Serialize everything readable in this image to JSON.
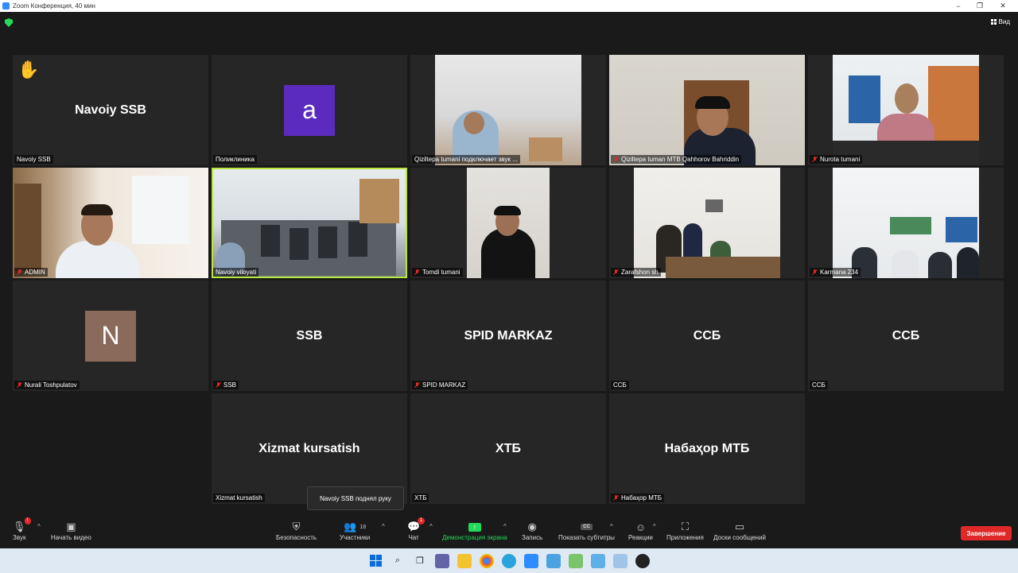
{
  "window": {
    "title": "Zoom Конференция, 40 мин",
    "minimize": "−",
    "maximize": "❐",
    "close": "✕"
  },
  "topbar": {
    "view_label": "Вид"
  },
  "tiles": [
    {
      "name": "Navoiy SSB",
      "display": "Navoiy SSB",
      "hand": "✋"
    },
    {
      "name": "Поликлиника",
      "avatar": "a"
    },
    {
      "name": "Qiziltepa tumani подключает звук ..."
    },
    {
      "name": "Qiziltepa tuman  MTB Qahhorov Bahriddin"
    },
    {
      "name": "Nurota tumani"
    },
    {
      "name": "ADMIN"
    },
    {
      "name": "Navoiy viloyati"
    },
    {
      "name": "Tomdi tumani"
    },
    {
      "name": "Zarafshon sh"
    },
    {
      "name": "Karmana 234"
    },
    {
      "name": "Nurali Toshpulatov",
      "avatar": "N"
    },
    {
      "name": "SSB",
      "display": "SSB"
    },
    {
      "name": "SPID MARKAZ",
      "display": "SPID MARKAZ"
    },
    {
      "name": "ССБ",
      "display": "ССБ"
    },
    {
      "name": "ССБ",
      "display": "ССБ"
    },
    {
      "name": "Xizmat kursatish",
      "display": "Xizmat kursatish"
    },
    {
      "name": "ХТБ",
      "display": "ХТБ"
    },
    {
      "name": "Набаҳор МТБ",
      "display": "Набаҳор МТБ"
    }
  ],
  "tooltip": "Navoiy SSB поднял руку",
  "toolbar": {
    "audio": "Звук",
    "audio_badge": "!",
    "video": "Начать видео",
    "security": "Безопасность",
    "participants": "Участники",
    "participants_count": "18",
    "chat": "Чат",
    "chat_badge": "1",
    "share": "Демонстрация экрана",
    "record": "Запись",
    "captions": "Показать субтитры",
    "captions_icon": "CC",
    "reactions": "Реакции",
    "apps": "Приложения",
    "whiteboards": "Доски сообщений",
    "end": "Завершение"
  },
  "colors": {
    "accent_green": "#23d959",
    "end_red": "#e02828",
    "active_speaker": "#b9e63c",
    "avatar_purple": "#5b2bbf",
    "avatar_brown": "#8a6a5a"
  }
}
